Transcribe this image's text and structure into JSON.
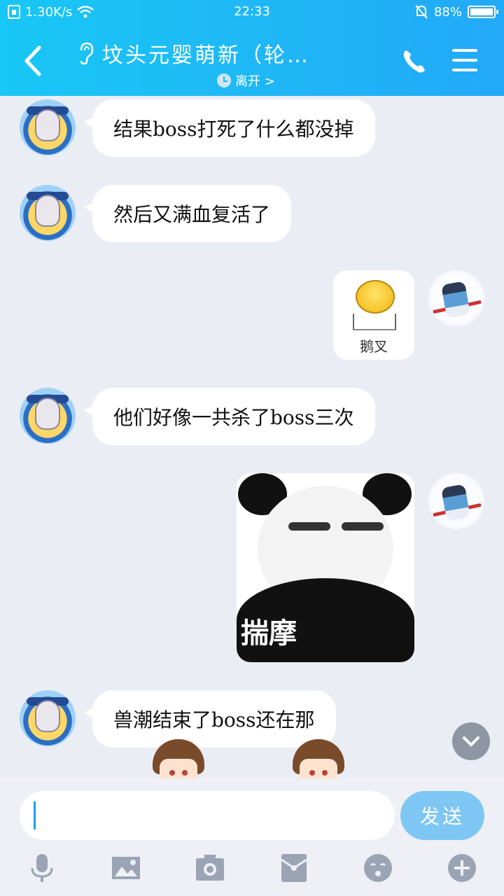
{
  "status_bar": {
    "speed": "1.30K/s",
    "time": "22:33",
    "battery_percent": "88%",
    "battery_level": 0.88
  },
  "header": {
    "title": "坟头元婴萌新（轮…",
    "presence": "离开 >"
  },
  "messages": [
    {
      "side": "left",
      "type": "text",
      "text": "结果boss打死了什么都没掉"
    },
    {
      "side": "left",
      "type": "text",
      "text": "然后又满血复活了"
    },
    {
      "side": "right",
      "type": "sticker",
      "caption": "鹅叉"
    },
    {
      "side": "left",
      "type": "text",
      "text": "他们好像一共杀了boss三次"
    },
    {
      "side": "right",
      "type": "sticker",
      "caption": "揣摩"
    },
    {
      "side": "left",
      "type": "text",
      "text": "兽潮结束了boss还在那"
    }
  ],
  "composer": {
    "send_label": "发送",
    "input_value": ""
  },
  "toolbar": {
    "icons": [
      "microphone-icon",
      "image-icon",
      "camera-icon",
      "red-packet-icon",
      "emoji-icon",
      "plus-icon"
    ]
  }
}
